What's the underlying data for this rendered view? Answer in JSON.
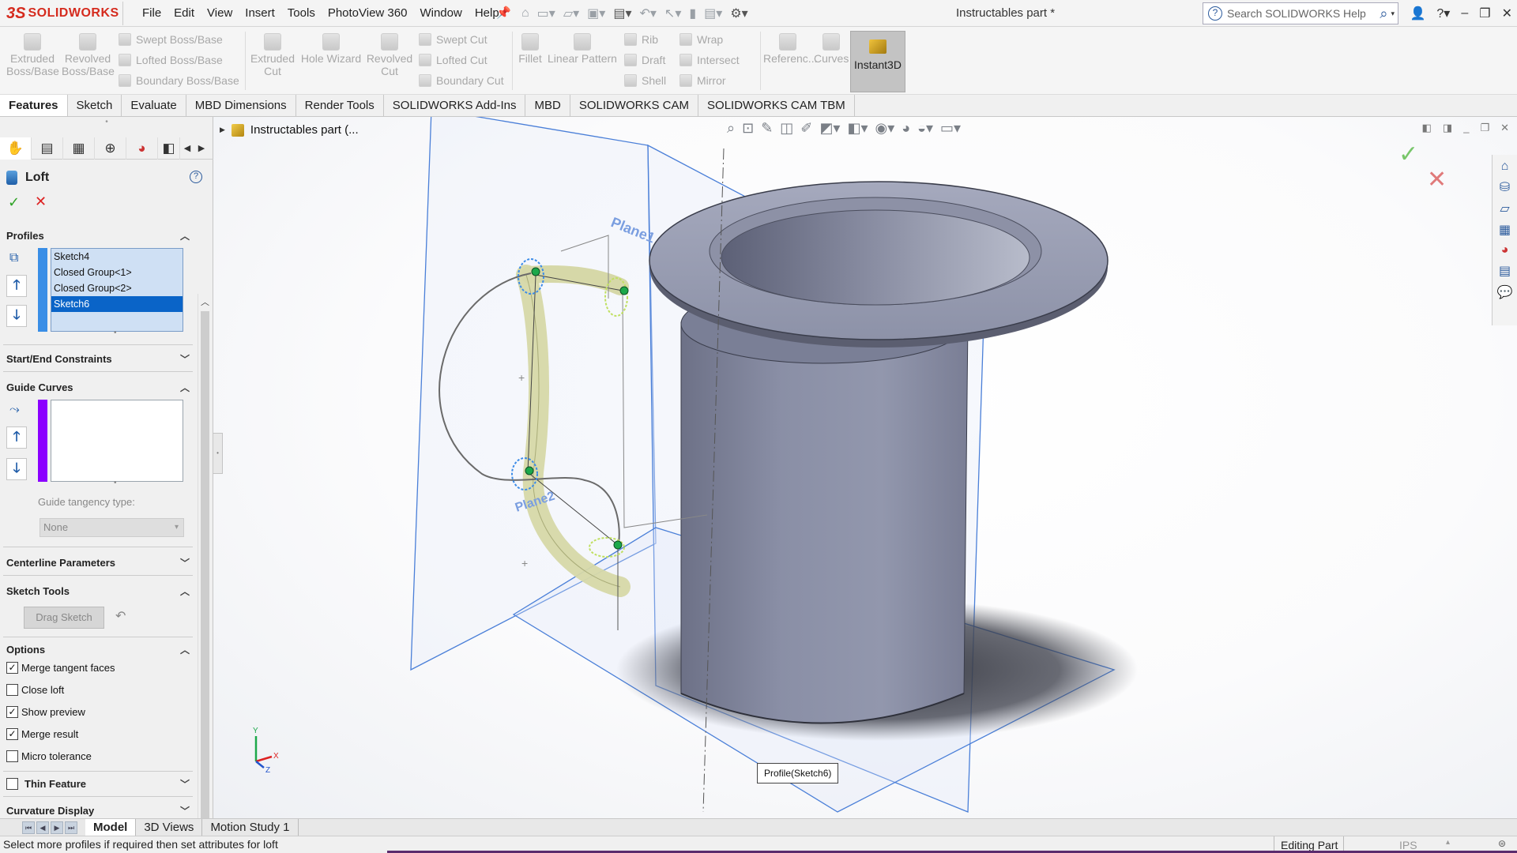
{
  "app": {
    "logo_mark": "3S",
    "logo_text": "SOLIDWORKS",
    "doc_title": "Instructables part *"
  },
  "menu": [
    "File",
    "Edit",
    "View",
    "Insert",
    "Tools",
    "PhotoView 360",
    "Window",
    "Help"
  ],
  "search": {
    "placeholder": "Search SOLIDWORKS Help"
  },
  "toolbar": {
    "extruded_boss": "Extruded Boss/Base",
    "revolved_boss": "Revolved Boss/Base",
    "swept_boss": "Swept Boss/Base",
    "lofted_boss": "Lofted Boss/Base",
    "boundary_boss": "Boundary Boss/Base",
    "extruded_cut": "Extruded Cut",
    "hole_wizard": "Hole Wizard",
    "revolved_cut": "Revolved Cut",
    "swept_cut": "Swept Cut",
    "lofted_cut": "Lofted Cut",
    "boundary_cut": "Boundary Cut",
    "fillet": "Fillet",
    "linear_pattern": "Linear Pattern",
    "rib": "Rib",
    "draft": "Draft",
    "shell": "Shell",
    "wrap": "Wrap",
    "intersect": "Intersect",
    "mirror": "Mirror",
    "reference": "Referenc...",
    "curves": "Curves",
    "instant3d": "Instant3D"
  },
  "tabs": [
    "Features",
    "Sketch",
    "Evaluate",
    "MBD Dimensions",
    "Render Tools",
    "SOLIDWORKS Add-Ins",
    "MBD",
    "SOLIDWORKS CAM",
    "SOLIDWORKS CAM TBM"
  ],
  "property_manager": {
    "title": "Loft",
    "profiles": {
      "header": "Profiles",
      "items": [
        "Sketch4",
        "Closed Group<1>",
        "Closed Group<2>",
        "Sketch6"
      ],
      "selected_index": 3
    },
    "start_end": "Start/End Constraints",
    "guide_curves": {
      "header": "Guide Curves",
      "tangency_label": "Guide tangency type:",
      "tangency_value": "None"
    },
    "centerline": "Centerline Parameters",
    "sketch_tools": {
      "header": "Sketch Tools",
      "drag_sketch": "Drag Sketch"
    },
    "options": {
      "header": "Options",
      "merge_tangent": "Merge tangent faces",
      "close_loft": "Close loft",
      "show_preview": "Show preview",
      "merge_result": "Merge result",
      "micro_tolerance": "Micro tolerance"
    },
    "thin_feature": "Thin Feature",
    "curvature_display": "Curvature Display"
  },
  "checkboxes": {
    "merge_tangent": true,
    "close_loft": false,
    "show_preview": true,
    "merge_result": true,
    "micro_tolerance": false,
    "thin_feature": false
  },
  "tree": {
    "root": "Instructables part  (..."
  },
  "viewport": {
    "plane1": "Plane1",
    "plane2": "Plane2",
    "tooltip": "Profile(Sketch6)",
    "triad": {
      "x": "X",
      "y": "Y",
      "z": "Z"
    }
  },
  "bottom_tabs": [
    "Model",
    "3D Views",
    "Motion Study 1"
  ],
  "status": {
    "message": "Select more profiles if required then set attributes for loft",
    "mode": "Editing Part",
    "units": "IPS"
  },
  "colors": {
    "accent": "#d52b1e",
    "selection": "#0a64c8",
    "guide_curve": "#8b00ff",
    "profile_strip": "#3a8ee6",
    "body": "#7d8299"
  }
}
